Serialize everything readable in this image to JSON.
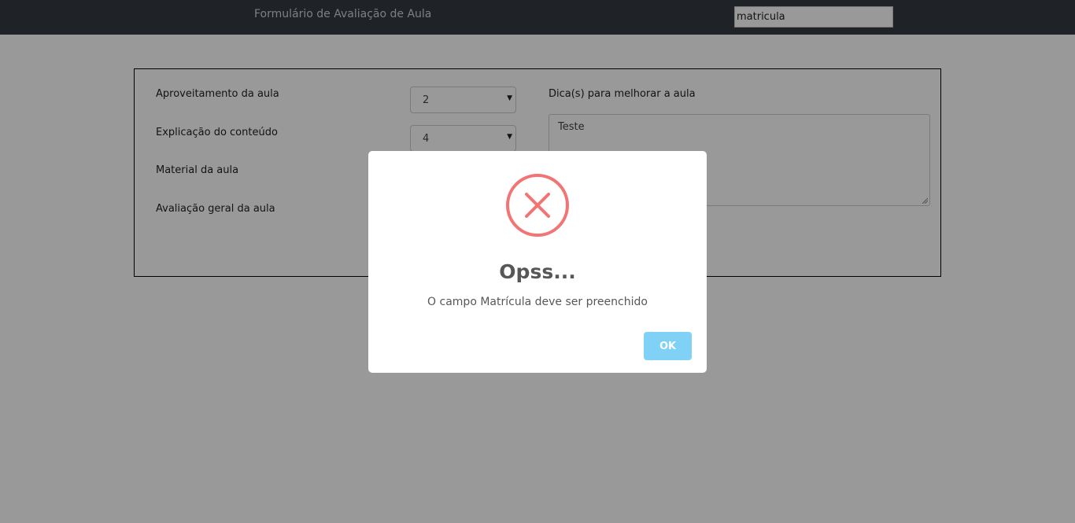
{
  "header": {
    "title": "Formulário de Avaliação de Aula",
    "matricula_value": "matricula"
  },
  "form": {
    "fields": [
      {
        "label": "Aproveitamento da aula",
        "value": "2"
      },
      {
        "label": "Explicação do conteúdo",
        "value": "4"
      },
      {
        "label": "Material da aula",
        "value": ""
      },
      {
        "label": "Avaliação geral da aula",
        "value": ""
      }
    ],
    "tips_label": "Dica(s) para melhorar a aula",
    "tips_value": "Teste"
  },
  "modal": {
    "icon": "error-x-icon",
    "title": "Opss...",
    "message": "O campo Matrícula deve ser preenchido",
    "ok_label": "OK",
    "colors": {
      "icon": "#f27474",
      "ok_button": "#7fd1f6",
      "title": "#575757"
    }
  }
}
